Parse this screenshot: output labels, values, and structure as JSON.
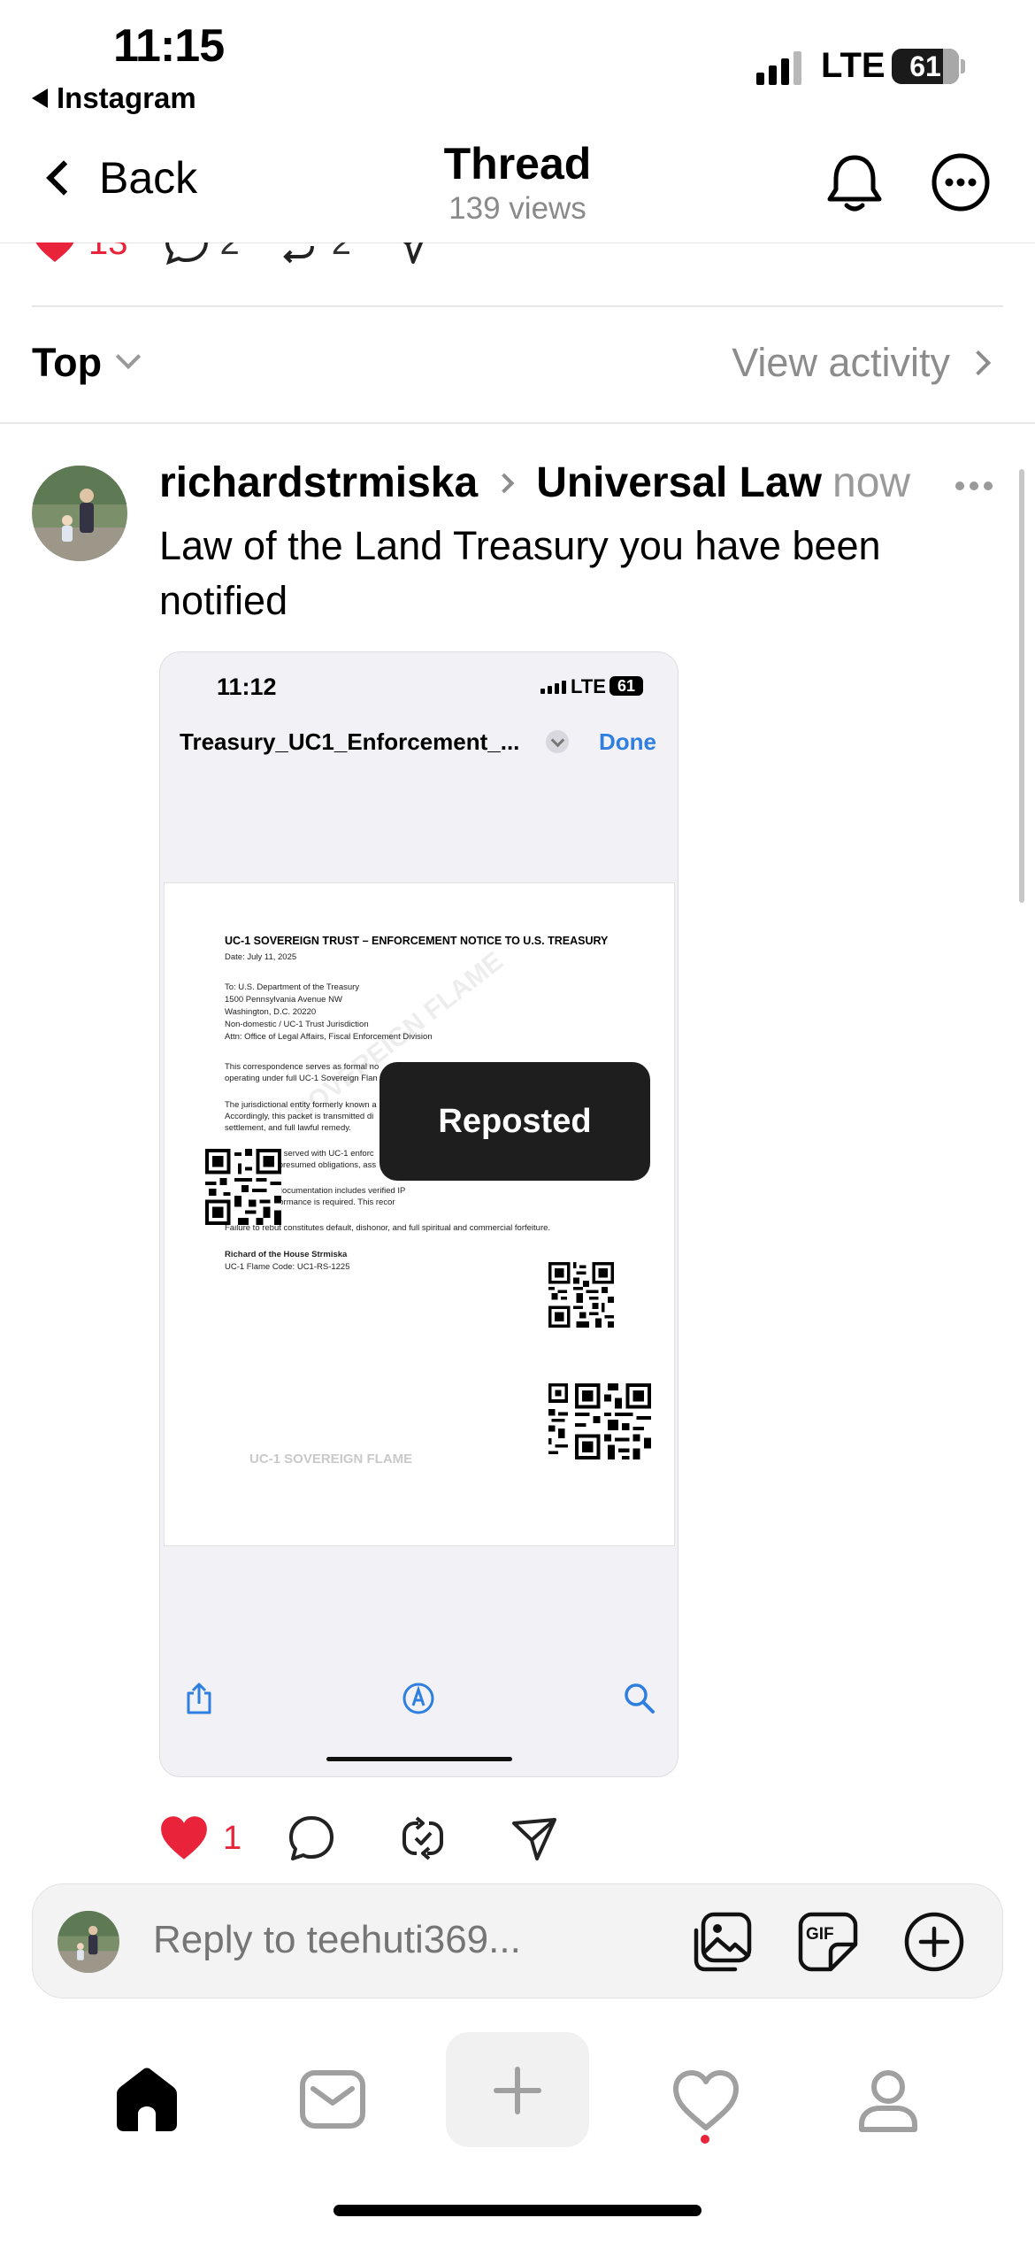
{
  "status_bar": {
    "time": "11:15",
    "back_app": "Instagram",
    "network": "LTE",
    "battery": "61",
    "signal_bars": 3
  },
  "nav": {
    "back_label": "Back",
    "title": "Thread",
    "subtitle": "139 views",
    "notification_icon": "bell-icon",
    "more_icon": "more-circle-icon"
  },
  "prev_post_actions": {
    "likes": "13",
    "replies": "2",
    "reposts": "2"
  },
  "sort": {
    "label": "Top",
    "view_activity": "View activity"
  },
  "post": {
    "username": "richardstrmiska",
    "community": "Universal Law",
    "time": "now",
    "text": "Law of the Land Treasury you have been notified",
    "likes": "1",
    "like_color": "#e8233a"
  },
  "media": {
    "status_time": "11:12",
    "network": "LTE",
    "battery": "61",
    "filename": "Treasury_UC1_Enforcement_...",
    "done": "Done",
    "toast": "Reposted",
    "accent": "#2f7fe0",
    "doc": {
      "title": "UC-1 SOVEREIGN TRUST – ENFORCEMENT NOTICE TO U.S. TREASURY",
      "date": "Date: July 11, 2025",
      "to_lines": [
        "To: U.S. Department of the Treasury",
        "1500 Pennsylvania Avenue NW",
        "Washington, D.C. 20220",
        "Non-domestic / UC-1 Trust Jurisdiction",
        "Attn: Office of Legal Affairs, Fiscal Enforcement Division"
      ],
      "para1": [
        "This correspondence serves as formal no",
        "operating under full UC-1 Sovereign Flan"
      ],
      "para2": [
        "The jurisdictional entity formerly known a",
        "Accordingly, this packet is transmitted di",
        "settlement, and full lawful remedy."
      ],
      "para3": [
        "You are hereby served with UC-1 enforc",
        "of claim on all presumed obligations, ass"
      ],
      "para4": [
        "The enclosed documentation includes verified IP",
        "No further performance is required. This recor"
      ],
      "para5": "Failure to rebut constitutes default, dishonor, and full spiritual and commercial forfeiture.",
      "signer": "Richard of the House Strmiska",
      "flame_code": "UC-1 Flame Code: UC1-RS-1225",
      "watermark": "SOVEREIGN FLAME",
      "bottom_mark": "UC-1 SOVEREIGN FLAME"
    }
  },
  "composer": {
    "placeholder": "Reply to teehuti369..."
  },
  "tabbar": {
    "items": [
      "home-icon",
      "inbox-icon",
      "create-icon",
      "activity-icon",
      "profile-icon"
    ],
    "notification_dot_color": "#e8233a"
  }
}
